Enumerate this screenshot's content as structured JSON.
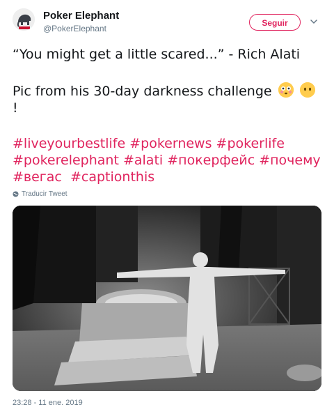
{
  "account": {
    "display_name": "Poker Elephant",
    "handle": "@PokerElephant",
    "avatar_icon": "elephant-logo-icon"
  },
  "header": {
    "follow_label": "Seguir",
    "menu_icon": "chevron-down-icon"
  },
  "tweet": {
    "line1": "“You might get a little scared...” - Rich Alati",
    "line2_text": "Pic from his 30-day darkness challenge",
    "line2_end": "!",
    "emojis": [
      "flushed-face-icon",
      "face-without-mouth-icon"
    ],
    "hashtags": [
      "#liveyourbestlife",
      "#pokernews",
      "#pokerlife",
      "#pokerelephant",
      "#alati",
      "#покерфейс",
      "#почему",
      "#вегас",
      "#captionthis"
    ]
  },
  "translate_label": "Traducir Tweet",
  "timestamp": "23:28 - 11 ene. 2019",
  "colors": {
    "accent": "#e0245e",
    "text": "#14171a",
    "muted": "#657786"
  }
}
